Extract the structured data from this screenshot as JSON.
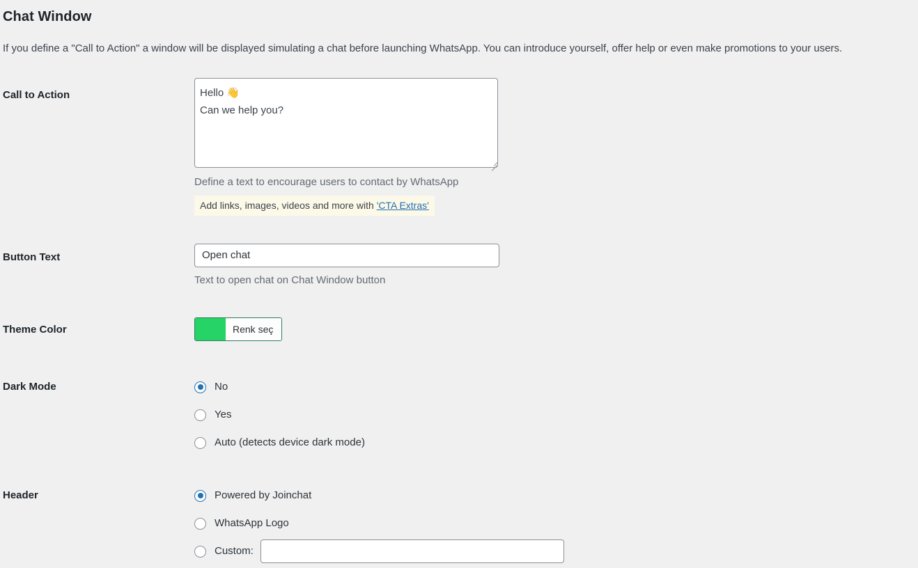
{
  "section": {
    "title": "Chat Window",
    "description": "If you define a \"Call to Action\" a window will be displayed simulating a chat before launching WhatsApp. You can introduce yourself, offer help or even make promotions to your users."
  },
  "call_to_action": {
    "label": "Call to Action",
    "value": "Hello 👋\nCan we help you?",
    "placeholder": "",
    "help": "Define a text to encourage users to contact by WhatsApp",
    "tip_prefix": "Add links, images, videos and more with ",
    "tip_link": "'CTA Extras'"
  },
  "button_text": {
    "label": "Button Text",
    "value": "Open chat",
    "placeholder": "",
    "help": "Text to open chat on Chat Window button"
  },
  "theme_color": {
    "label": "Theme Color",
    "swatch_hex": "#25d366",
    "picker_label": "Renk seç"
  },
  "dark_mode": {
    "label": "Dark Mode",
    "selected": "no",
    "options": [
      {
        "id": "no",
        "label": "No",
        "checked": true
      },
      {
        "id": "yes",
        "label": "Yes",
        "checked": false
      },
      {
        "id": "auto",
        "label": "Auto (detects device dark mode)",
        "checked": false
      }
    ]
  },
  "header": {
    "label": "Header",
    "selected": "powered",
    "options": [
      {
        "id": "powered",
        "label": "Powered by Joinchat",
        "checked": true
      },
      {
        "id": "whatsapp",
        "label": "WhatsApp Logo",
        "checked": false
      },
      {
        "id": "custom",
        "label": "Custom:",
        "checked": false
      }
    ],
    "custom_value": "",
    "custom_placeholder": ""
  },
  "colors": {
    "page_background": "#f0f0f1",
    "accent": "#2271b1",
    "brand_green": "#25d366",
    "tip_background": "#fcf9e8",
    "border": "#8c8f94"
  }
}
